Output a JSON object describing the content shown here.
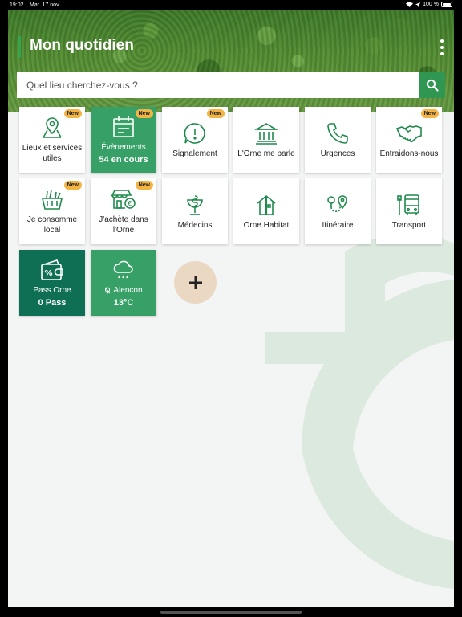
{
  "status": {
    "time": "19:02",
    "date": "Mar. 17 nov.",
    "battery": "100 %"
  },
  "header": {
    "title": "Mon quotidien"
  },
  "search": {
    "placeholder": "Quel lieu cherchez-vous ?"
  },
  "colors": {
    "brand_green": "#37a34a",
    "tile_green": "#37a066",
    "tile_dark": "#0f6f55",
    "badge": "#f2b544",
    "add": "#ead8c3"
  },
  "tiles": [
    {
      "label": "Lieux et services utiles",
      "icon": "map-pin-icon",
      "badge": "New"
    },
    {
      "label": "Évènements",
      "value": "54 en cours",
      "icon": "calendar-icon",
      "badge": "New"
    },
    {
      "label": "Signalement",
      "icon": "alert-icon",
      "badge": "New"
    },
    {
      "label": "L'Orne me parle",
      "icon": "building-icon"
    },
    {
      "label": "Urgences",
      "icon": "phone-icon"
    },
    {
      "label": "Entraidons-nous",
      "icon": "handshake-icon",
      "badge": "New"
    },
    {
      "label": "Je consomme local",
      "icon": "basket-icon",
      "badge": "New"
    },
    {
      "label": "J'achète dans l'Orne",
      "icon": "shop-icon",
      "badge": "New"
    },
    {
      "label": "Médecins",
      "icon": "caduceus-icon"
    },
    {
      "label": "Orne Habitat",
      "icon": "house-icon"
    },
    {
      "label": "Itinéraire",
      "icon": "route-icon"
    },
    {
      "label": "Transport",
      "icon": "bus-icon"
    },
    {
      "label": "Pass Orne",
      "value": "0 Pass",
      "icon": "wallet-icon"
    },
    {
      "label": "Alencon",
      "value": "13°C",
      "icon": "weather-icon"
    }
  ]
}
